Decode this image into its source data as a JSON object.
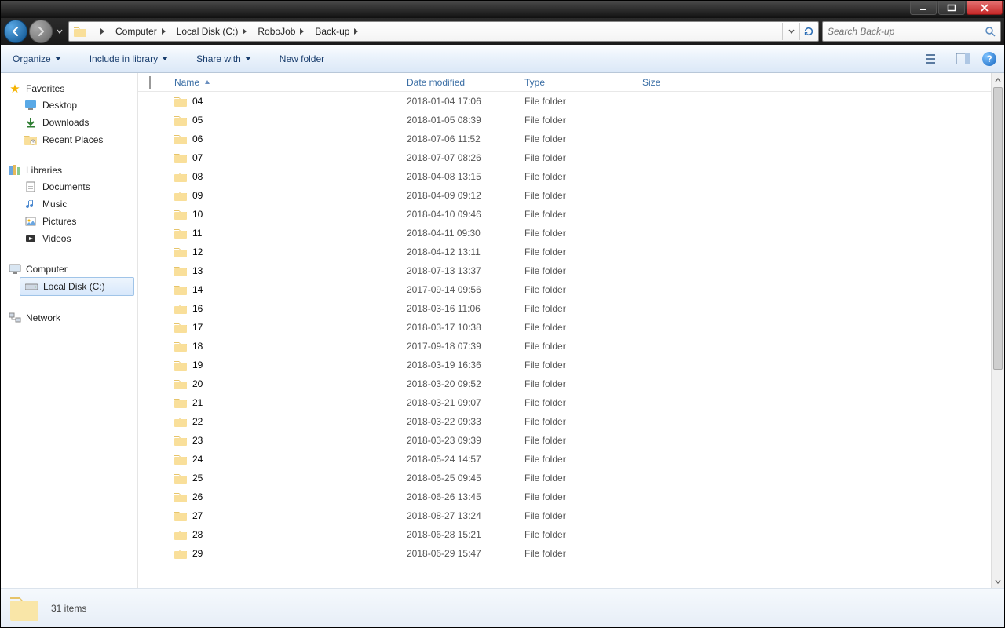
{
  "titlebar": {
    "minimize": "",
    "maximize": "",
    "close": ""
  },
  "breadcrumbs": [
    "Computer",
    "Local Disk (C:)",
    "RoboJob",
    "Back-up"
  ],
  "search": {
    "placeholder": "Search Back-up"
  },
  "toolbar": {
    "organize": "Organize",
    "include": "Include in library",
    "share": "Share with",
    "newfolder": "New folder"
  },
  "navpane": {
    "favorites": {
      "label": "Favorites",
      "items": [
        "Desktop",
        "Downloads",
        "Recent Places"
      ]
    },
    "libraries": {
      "label": "Libraries",
      "items": [
        "Documents",
        "Music",
        "Pictures",
        "Videos"
      ]
    },
    "computer": {
      "label": "Computer",
      "items": [
        "Local Disk (C:)"
      ]
    },
    "network": {
      "label": "Network"
    }
  },
  "columns": {
    "name": "Name",
    "date": "Date modified",
    "type": "Type",
    "size": "Size"
  },
  "files": [
    {
      "name": "04",
      "date": "2018-01-04 17:06",
      "type": "File folder",
      "size": ""
    },
    {
      "name": "05",
      "date": "2018-01-05 08:39",
      "type": "File folder",
      "size": ""
    },
    {
      "name": "06",
      "date": "2018-07-06 11:52",
      "type": "File folder",
      "size": ""
    },
    {
      "name": "07",
      "date": "2018-07-07 08:26",
      "type": "File folder",
      "size": ""
    },
    {
      "name": "08",
      "date": "2018-04-08 13:15",
      "type": "File folder",
      "size": ""
    },
    {
      "name": "09",
      "date": "2018-04-09 09:12",
      "type": "File folder",
      "size": ""
    },
    {
      "name": "10",
      "date": "2018-04-10 09:46",
      "type": "File folder",
      "size": ""
    },
    {
      "name": "11",
      "date": "2018-04-11 09:30",
      "type": "File folder",
      "size": ""
    },
    {
      "name": "12",
      "date": "2018-04-12 13:11",
      "type": "File folder",
      "size": ""
    },
    {
      "name": "13",
      "date": "2018-07-13 13:37",
      "type": "File folder",
      "size": ""
    },
    {
      "name": "14",
      "date": "2017-09-14 09:56",
      "type": "File folder",
      "size": ""
    },
    {
      "name": "16",
      "date": "2018-03-16 11:06",
      "type": "File folder",
      "size": ""
    },
    {
      "name": "17",
      "date": "2018-03-17 10:38",
      "type": "File folder",
      "size": ""
    },
    {
      "name": "18",
      "date": "2017-09-18 07:39",
      "type": "File folder",
      "size": ""
    },
    {
      "name": "19",
      "date": "2018-03-19 16:36",
      "type": "File folder",
      "size": ""
    },
    {
      "name": "20",
      "date": "2018-03-20 09:52",
      "type": "File folder",
      "size": ""
    },
    {
      "name": "21",
      "date": "2018-03-21 09:07",
      "type": "File folder",
      "size": ""
    },
    {
      "name": "22",
      "date": "2018-03-22 09:33",
      "type": "File folder",
      "size": ""
    },
    {
      "name": "23",
      "date": "2018-03-23 09:39",
      "type": "File folder",
      "size": ""
    },
    {
      "name": "24",
      "date": "2018-05-24 14:57",
      "type": "File folder",
      "size": ""
    },
    {
      "name": "25",
      "date": "2018-06-25 09:45",
      "type": "File folder",
      "size": ""
    },
    {
      "name": "26",
      "date": "2018-06-26 13:45",
      "type": "File folder",
      "size": ""
    },
    {
      "name": "27",
      "date": "2018-08-27 13:24",
      "type": "File folder",
      "size": ""
    },
    {
      "name": "28",
      "date": "2018-06-28 15:21",
      "type": "File folder",
      "size": ""
    },
    {
      "name": "29",
      "date": "2018-06-29 15:47",
      "type": "File folder",
      "size": ""
    }
  ],
  "status": {
    "count": "31 items"
  }
}
